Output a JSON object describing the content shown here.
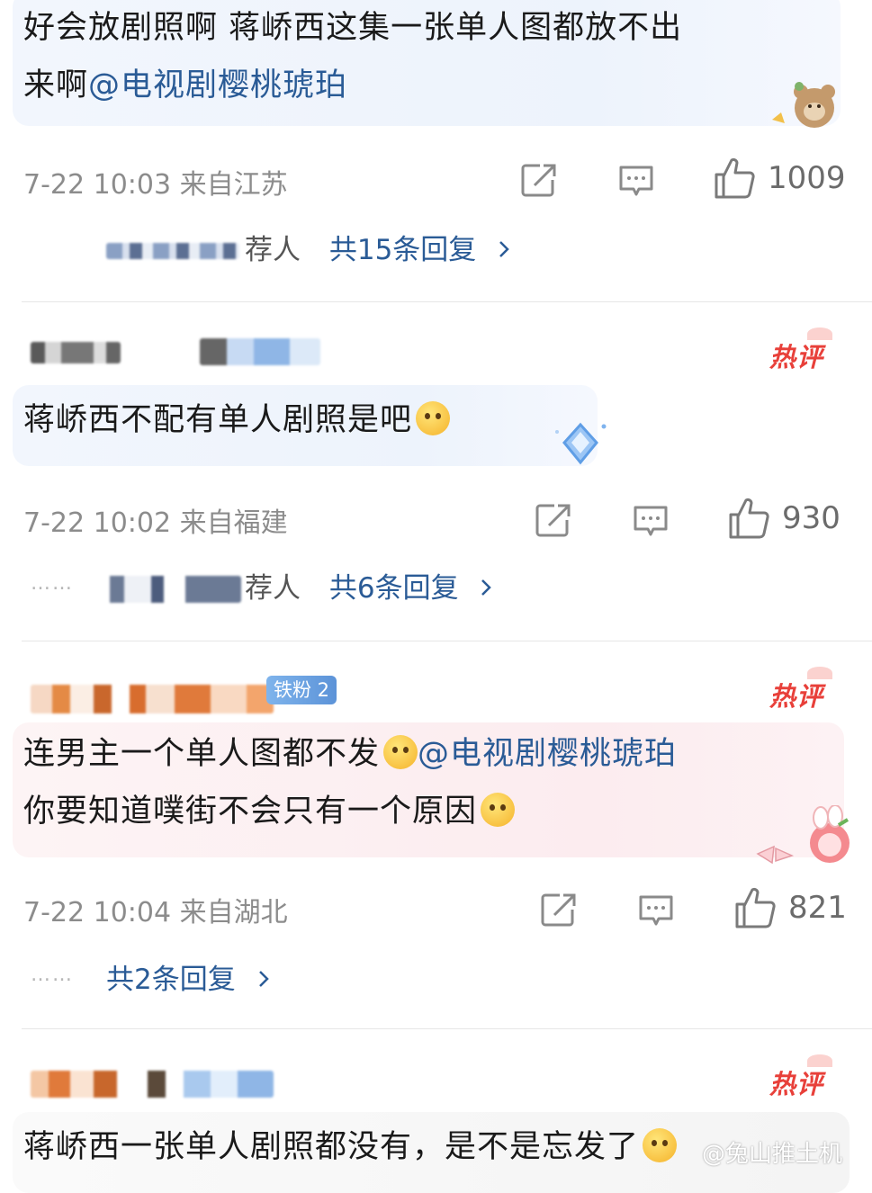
{
  "comments": [
    {
      "text_line1": "好会放剧照啊 蒋峤西这集一张单人图都放不出",
      "text_line2_prefix": "来啊",
      "mention": "@电视剧樱桃琥珀",
      "meta": "7-22 10:03 来自江苏",
      "likes": "1009",
      "replies_suffix": "荐人",
      "replies_label": "共15条回复"
    },
    {
      "hot_label": "热评",
      "text_line1": "蒋峤西不配有单人剧照是吧",
      "meta": "7-22 10:02 来自福建",
      "likes": "930",
      "replies_suffix": "荐人",
      "replies_label": "共6条回复",
      "dots": "……"
    },
    {
      "hot_label": "热评",
      "badge": "铁粉 2",
      "text_line1_prefix": "连男主一个单人图都不发",
      "mention": "@电视剧樱桃琥珀",
      "text_line2": "你要知道噗街不会只有一个原因",
      "meta": "7-22 10:04 来自湖北",
      "likes": "821",
      "replies_label": "共2条回复",
      "dots": "……"
    },
    {
      "hot_label": "热评",
      "text_line1": "蒋峤西一张单人剧照都没有，是不是忘发了"
    }
  ],
  "watermark": "@兔山推土机",
  "icons": {
    "share": "share-icon",
    "comment": "comment-icon",
    "like": "thumbs-up-icon",
    "chevron": "chevron-right-icon"
  },
  "colors": {
    "link": "#2a5b96",
    "hot": "#e8403a",
    "meta": "#8c8c8c"
  }
}
